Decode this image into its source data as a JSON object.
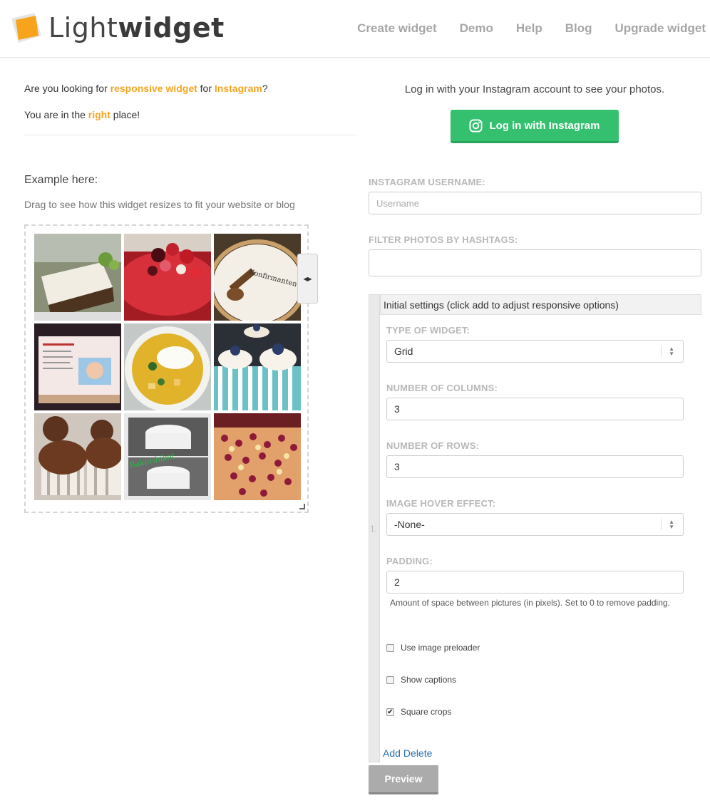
{
  "header": {
    "logo_light": "Light",
    "logo_bold": "widget",
    "nav": [
      "Create widget",
      "Demo",
      "Help",
      "Blog",
      "Upgrade widget"
    ]
  },
  "intro": {
    "line1_a": "Are you looking for ",
    "line1_hl1": "responsive widget",
    "line1_b": " for ",
    "line1_hl2": "Instagram",
    "line1_c": "?",
    "line2_a": "You are in the ",
    "line2_hl": "right",
    "line2_b": " place!"
  },
  "example": {
    "title": "Example here:",
    "subtitle": "Drag to see how this widget resizes to fit your website or blog",
    "tiles": [
      "cake-slice",
      "berry-cake",
      "guitar-cake",
      "book-cake",
      "curry-soup",
      "blueberry-cupcakes",
      "chocolate-cupcakes",
      "bakeries-cake",
      "berry-tart"
    ]
  },
  "login": {
    "prompt": "Log in with your Instagram account to see your photos.",
    "button": "Log in with Instagram",
    "color": "#34c06e"
  },
  "form": {
    "username_label": "INSTAGRAM USERNAME:",
    "username_placeholder": "Username",
    "hashtags_label": "FILTER PHOTOS BY HASHTAGS:",
    "hashtags_value": "",
    "settings_header": "Initial settings (click add to adjust responsive options)",
    "row_number": "1.",
    "type_label": "TYPE OF WIDGET:",
    "type_value": "Grid",
    "columns_label": "NUMBER OF COLUMNS:",
    "columns_value": "3",
    "rows_label": "NUMBER OF ROWS:",
    "rows_value": "3",
    "hover_label": "IMAGE HOVER EFFECT:",
    "hover_value": "-None-",
    "padding_label": "PADDING:",
    "padding_value": "2",
    "padding_help": "Amount of space between pictures (in pixels). Set to 0 to remove padding.",
    "preloader_label": "Use image preloader",
    "preloader_checked": false,
    "captions_label": "Show captions",
    "captions_checked": false,
    "square_label": "Square crops",
    "square_checked": true,
    "add_link": "Add",
    "delete_link": "Delete",
    "preview_button": "Preview"
  }
}
